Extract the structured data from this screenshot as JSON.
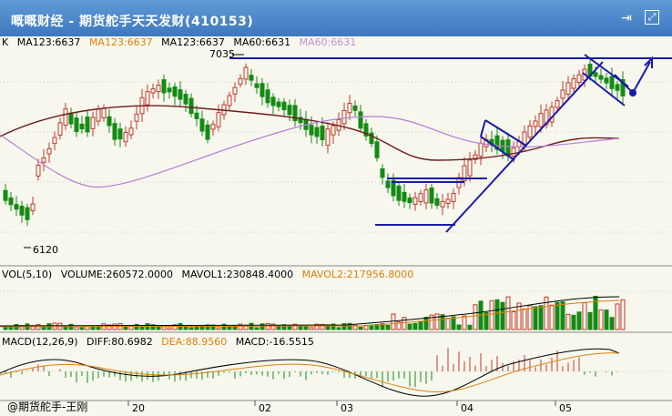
{
  "window": {
    "title": "嘅嘅财经 - 期货舵手天天发财(410153)"
  },
  "price_panel": {
    "prefix": "K",
    "indicators": [
      {
        "label": "MA123:6637",
        "color": "#000000"
      },
      {
        "label": "MA123:6637",
        "color": "#e0800a"
      },
      {
        "label": "MA123:6637",
        "color": "#000000"
      },
      {
        "label": "MA60:6631",
        "color": "#000000"
      },
      {
        "label": "MA60:6631",
        "color": "#c98fd6"
      }
    ],
    "high_label": "7035",
    "low_label": "6120"
  },
  "volume_panel": {
    "indicators": [
      {
        "label": "VOL(5,10)",
        "color": "#000000"
      },
      {
        "label": "VOLUME:260572.0000",
        "color": "#000000"
      },
      {
        "label": "MAVOL1:230848.4000",
        "color": "#000000"
      },
      {
        "label": "MAVOL2:217956.8000",
        "color": "#e0800a"
      }
    ]
  },
  "macd_panel": {
    "indicators": [
      {
        "label": "MACD(12,26,9)",
        "color": "#000000"
      },
      {
        "label": "DIFF:80.6982",
        "color": "#000000"
      },
      {
        "label": "DEA:88.9560",
        "color": "#e0800a"
      },
      {
        "label": "MACD:-16.5515",
        "color": "#000000"
      }
    ]
  },
  "x_axis": {
    "labels": [
      "20",
      "02",
      "03",
      "04",
      "05"
    ]
  },
  "footer": {
    "text": "@期货舵手-王刚"
  },
  "colors": {
    "up": "#c0392b",
    "down": "#138b13",
    "trend": "#1a1aa8",
    "ma_slow": "#6b1d1d",
    "ma_fast": "#b67fd6",
    "panel_bg": "#f7f7ee"
  }
}
